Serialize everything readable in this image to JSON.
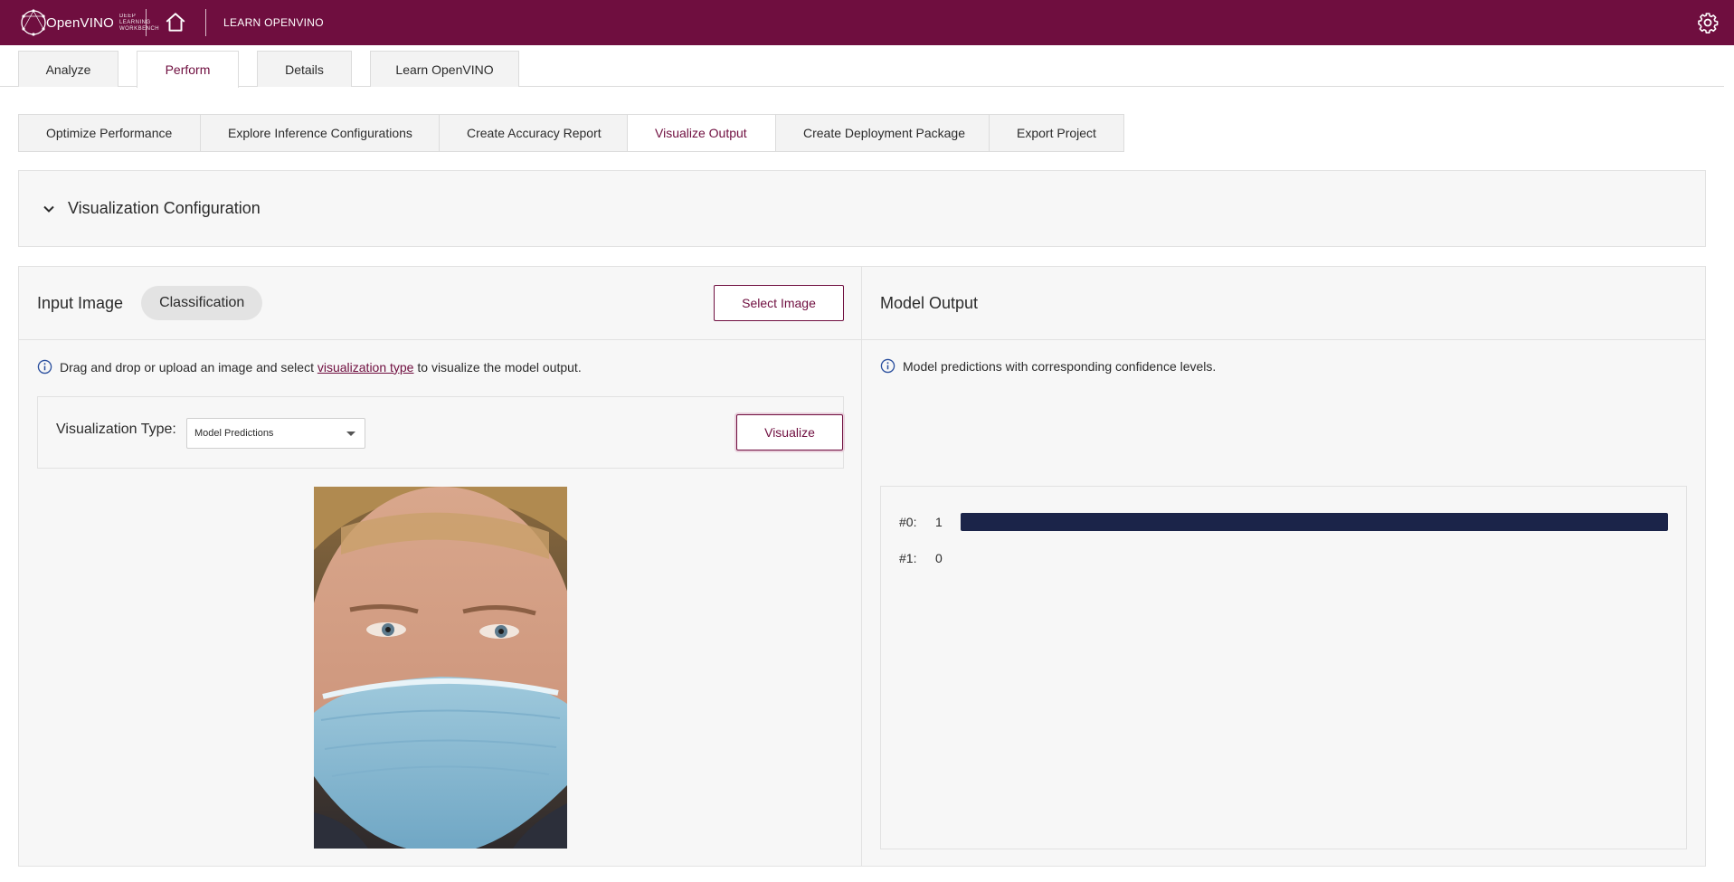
{
  "topbar": {
    "logo_word": "OpenVINO",
    "logo_sub": "DEEP LEARNING WORKBENCH",
    "learn_label": "LEARN OPENVINO",
    "bg_color": "#6f0e3f"
  },
  "main_tabs": [
    {
      "label": "Analyze",
      "active": false
    },
    {
      "label": "Perform",
      "active": true
    },
    {
      "label": "Details",
      "active": false
    },
    {
      "label": "Learn OpenVINO",
      "active": false
    }
  ],
  "sub_tabs": [
    {
      "label": "Optimize Performance",
      "active": false
    },
    {
      "label": "Explore Inference Configurations",
      "active": false
    },
    {
      "label": "Create Accuracy Report",
      "active": false
    },
    {
      "label": "Visualize Output",
      "active": true
    },
    {
      "label": "Create Deployment Package",
      "active": false
    },
    {
      "label": "Export Project",
      "active": false
    }
  ],
  "config_panel": {
    "title": "Visualization Configuration"
  },
  "input_panel": {
    "title": "Input Image",
    "chip": "Classification",
    "select_image_label": "Select Image",
    "info_prefix": "Drag and drop or upload an image and select",
    "info_link": "visualization type",
    "info_suffix": "to visualize the model output.",
    "viz_type_label": "Visualization Type:",
    "viz_type_value": "Model Predictions",
    "visualize_label": "Visualize"
  },
  "output_panel": {
    "title": "Model Output",
    "info": "Model predictions with corresponding confidence levels.",
    "predictions": [
      {
        "label": "#0:",
        "value": "1",
        "confidence": 1.0
      },
      {
        "label": "#1:",
        "value": "0",
        "confidence": 0.0
      }
    ]
  }
}
